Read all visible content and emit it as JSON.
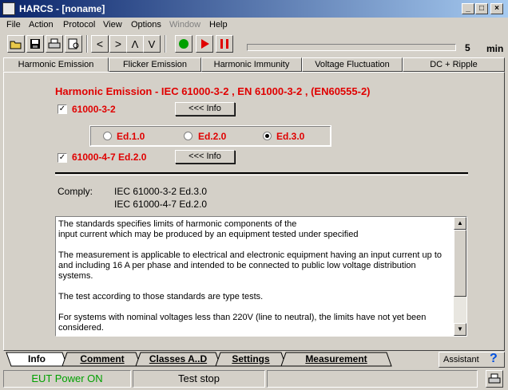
{
  "window": {
    "title": "HARCS - [noname]",
    "min": "_",
    "max": "□",
    "close": "×"
  },
  "menu": [
    "File",
    "Action",
    "Protocol",
    "View",
    "Options",
    "Window",
    "Help"
  ],
  "toolbar": {
    "nav": [
      "<",
      ">",
      "Λ",
      "V"
    ],
    "progress_value": "5",
    "progress_unit": "min",
    "progress_fraction": 0
  },
  "tabs": [
    "Harmonic Emission",
    "Flicker Emission",
    "Harmonic Immunity",
    "Voltage Fluctuation",
    "DC + Ripple"
  ],
  "main": {
    "heading": "Harmonic Emission - IEC 61000-3-2 , EN 61000-3-2 , (EN60555-2)",
    "std1": {
      "checked": true,
      "label": "61000-3-2",
      "button": "<<< Info"
    },
    "editions": [
      {
        "label": "Ed.1.0",
        "selected": false
      },
      {
        "label": "Ed.2.0",
        "selected": false
      },
      {
        "label": "Ed.3.0",
        "selected": true
      }
    ],
    "std2": {
      "checked": true,
      "label": "61000-4-7 Ed.2.0",
      "button": "<<< Info"
    },
    "comply_label": "Comply:",
    "comply": [
      "IEC 61000-3-2 Ed.3.0",
      "IEC 61000-4-7 Ed.2.0"
    ],
    "description": [
      "The standards specifies limits of harmonic components of the",
      "input current which may be produced by an equipment tested under specified",
      "",
      "The measurement is applicable to electrical and electronic equipment having an input current up to and including 16 A per phase and intended to be connected to public low voltage distribution systems.",
      "",
      "The test according to those standards are type tests.",
      "",
      "For systems with nominal voltages less than 220V (line to neutral), the limits have not yet been considered."
    ]
  },
  "bottom_tabs": [
    "Info",
    "Comment",
    "Classes A..D",
    "Settings",
    "Measurement"
  ],
  "assistant": {
    "label": "Assistant",
    "icon": "?"
  },
  "status": {
    "power": "EUT Power ON",
    "test": "Test stop"
  },
  "colors": {
    "red": "#e00000",
    "green": "#00a000",
    "title_start": "#0a246a",
    "title_end": "#a6caf0"
  }
}
